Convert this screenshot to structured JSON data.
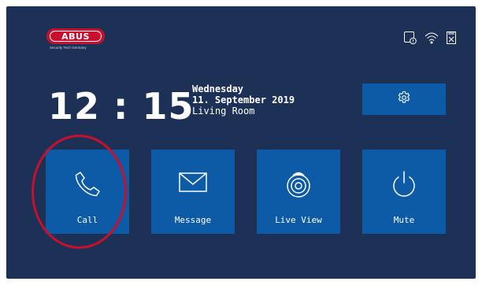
{
  "logo": {
    "brand": "ABUS",
    "tagline": "Security Tech Germany"
  },
  "status_icons": [
    "phone-memory-icon",
    "wifi-icon",
    "sd-card-missing-icon"
  ],
  "clock": {
    "time": "12:15"
  },
  "date_info": {
    "weekday": "Wednesday",
    "date": "11. September 2019",
    "location": "Living Room"
  },
  "settings": {
    "icon": "gear-icon"
  },
  "tiles": [
    {
      "label": "Call",
      "icon": "phone-icon"
    },
    {
      "label": "Message",
      "icon": "envelope-icon"
    },
    {
      "label": "Live View",
      "icon": "camera-icon"
    },
    {
      "label": "Mute",
      "icon": "power-icon"
    }
  ],
  "colors": {
    "background": "#1d3157",
    "tile": "#0d5aa7",
    "accent": "#c8102e"
  }
}
